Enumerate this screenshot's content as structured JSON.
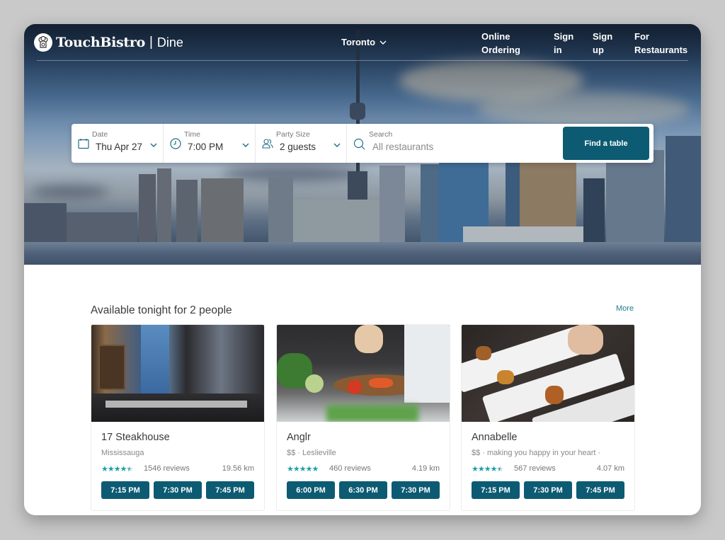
{
  "header": {
    "brand": "TouchBistro",
    "product": "Dine",
    "separator": "|",
    "city": "Toronto",
    "links": [
      {
        "line1": "Online",
        "line2": "Ordering"
      },
      {
        "line1": "Sign",
        "line2": "in"
      },
      {
        "line1": "Sign",
        "line2": "up"
      },
      {
        "line1": "For",
        "line2": "Restaurants"
      }
    ]
  },
  "search": {
    "date": {
      "label": "Date",
      "value": "Thu Apr 27",
      "icon": "calendar-icon"
    },
    "time": {
      "label": "Time",
      "value": "7:00 PM",
      "icon": "clock-icon"
    },
    "party": {
      "label": "Party Size",
      "value": "2 guests",
      "icon": "people-icon"
    },
    "query": {
      "label": "Search",
      "placeholder": "All restaurants",
      "icon": "search-icon"
    },
    "button": "Find a table"
  },
  "section": {
    "title": "Available tonight for 2 people",
    "more": "More"
  },
  "restaurants": [
    {
      "name": "17 Steakhouse",
      "subtitle": "Mississauga",
      "rating": 4.5,
      "stars": "★★★★",
      "reviews": "1546 reviews",
      "distance": "19.56 km",
      "slots": [
        "7:15 PM",
        "7:30 PM",
        "7:45 PM"
      ]
    },
    {
      "name": "Anglr",
      "subtitle": "$$ · Leslieville",
      "rating": 5,
      "stars": "★★★★★",
      "reviews": "460 reviews",
      "distance": "4.19 km",
      "slots": [
        "6:00 PM",
        "6:30 PM",
        "7:30 PM"
      ]
    },
    {
      "name": "Annabelle",
      "subtitle": "$$ · making you happy in your heart ·",
      "rating": 4.5,
      "stars": "★★★★",
      "reviews": "567 reviews",
      "distance": "4.07 km",
      "slots": [
        "7:15 PM",
        "7:30 PM",
        "7:45 PM"
      ]
    }
  ],
  "colors": {
    "accent": "#0d5b73",
    "star": "#1fa0a8",
    "link": "#1f7b8c"
  }
}
